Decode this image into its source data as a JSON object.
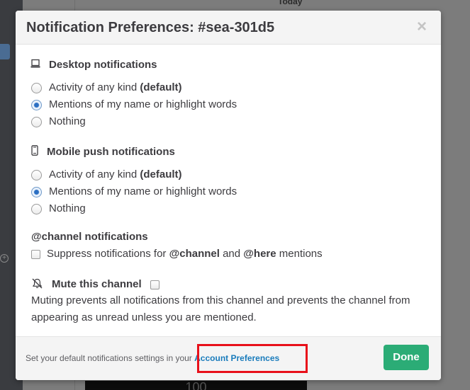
{
  "background": {
    "today_label": "Today",
    "bottom_text": "100"
  },
  "modal": {
    "title": "Notification Preferences: #sea-301d5",
    "close_glyph": "×"
  },
  "desktop": {
    "heading": "Desktop notifications",
    "icon": "laptop-icon",
    "options": [
      {
        "text": "Activity of any kind ",
        "bold": "(default)",
        "checked": false
      },
      {
        "text": "Mentions of my name or highlight words",
        "bold": "",
        "checked": true
      },
      {
        "text": "Nothing",
        "bold": "",
        "checked": false
      }
    ]
  },
  "mobile": {
    "heading": "Mobile push notifications",
    "icon": "mobile-phone-icon",
    "options": [
      {
        "text": "Activity of any kind ",
        "bold": "(default)",
        "checked": false
      },
      {
        "text": "Mentions of my name or highlight words",
        "bold": "",
        "checked": true
      },
      {
        "text": "Nothing",
        "bold": "",
        "checked": false
      }
    ]
  },
  "channel": {
    "heading": "@channel notifications",
    "suppress_pre": "Suppress notifications for ",
    "suppress_channel": "@channel",
    "suppress_mid": " and ",
    "suppress_here": "@here",
    "suppress_post": " mentions",
    "checked": false
  },
  "mute": {
    "heading": "Mute this channel",
    "icon": "muted-bell-icon",
    "checked": false,
    "description": "Muting prevents all notifications from this channel and prevents the channel from appearing as unread unless you are mentioned."
  },
  "footer": {
    "text": "Set your default notifications settings in your ",
    "link": "Account Preferences",
    "done": "Done"
  },
  "colors": {
    "accent_link": "#1a7cbc",
    "done_green": "#2bac76",
    "highlight_red": "#e8101a"
  }
}
